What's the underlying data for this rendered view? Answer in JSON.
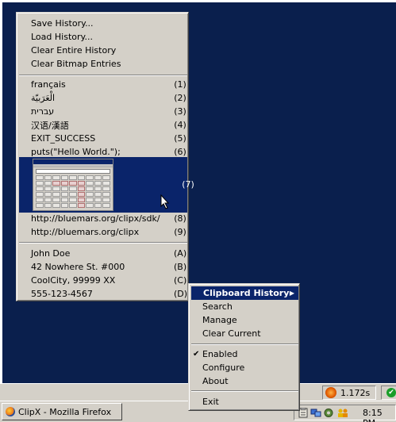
{
  "history_menu": {
    "file_actions": [
      {
        "label": "Save History..."
      },
      {
        "label": "Load History..."
      },
      {
        "label": "Clear Entire History"
      },
      {
        "label": "Clear Bitmap Entries"
      }
    ],
    "entries": [
      {
        "label": "français",
        "key": "(1)"
      },
      {
        "label": "الْعَرَبيّة",
        "key": "(2)"
      },
      {
        "label": "עברית",
        "key": "(3)"
      },
      {
        "label": "汉语/漢語",
        "key": "(4)"
      },
      {
        "label": "EXIT_SUCCESS",
        "key": "(5)"
      },
      {
        "label": "puts(\"Hello World.\");",
        "key": "(6)"
      }
    ],
    "bitmap_entry_key": "(7)",
    "url_entries": [
      {
        "label": "http://bluemars.org/clipx/sdk/",
        "key": "(8)"
      },
      {
        "label": "http://bluemars.org/clipx",
        "key": "(9)"
      }
    ],
    "contact_entries": [
      {
        "label": "John Doe",
        "key": "(A)"
      },
      {
        "label": "42 Nowhere St. #000",
        "key": "(B)"
      },
      {
        "label": "CoolCity, 99999 XX",
        "key": "(C)"
      },
      {
        "label": "555-123-4567",
        "key": "(D)"
      }
    ]
  },
  "tray_menu": {
    "header": "Clipboard History",
    "items": [
      {
        "label": "Search"
      },
      {
        "label": "Manage"
      },
      {
        "label": "Clear Current"
      }
    ],
    "options": [
      {
        "label": "Enabled",
        "checked": true
      },
      {
        "label": "Configure"
      },
      {
        "label": "About"
      }
    ],
    "exit_label": "Exit"
  },
  "taskbar": {
    "task_button": "ClipX - Mozilla Firefox",
    "tray_timer": "1.172s",
    "clock": "8:15 PM"
  },
  "colors": {
    "desktop": "#0a1f4d",
    "menu_bg": "#d4d0c8",
    "highlight": "#0a246a"
  }
}
